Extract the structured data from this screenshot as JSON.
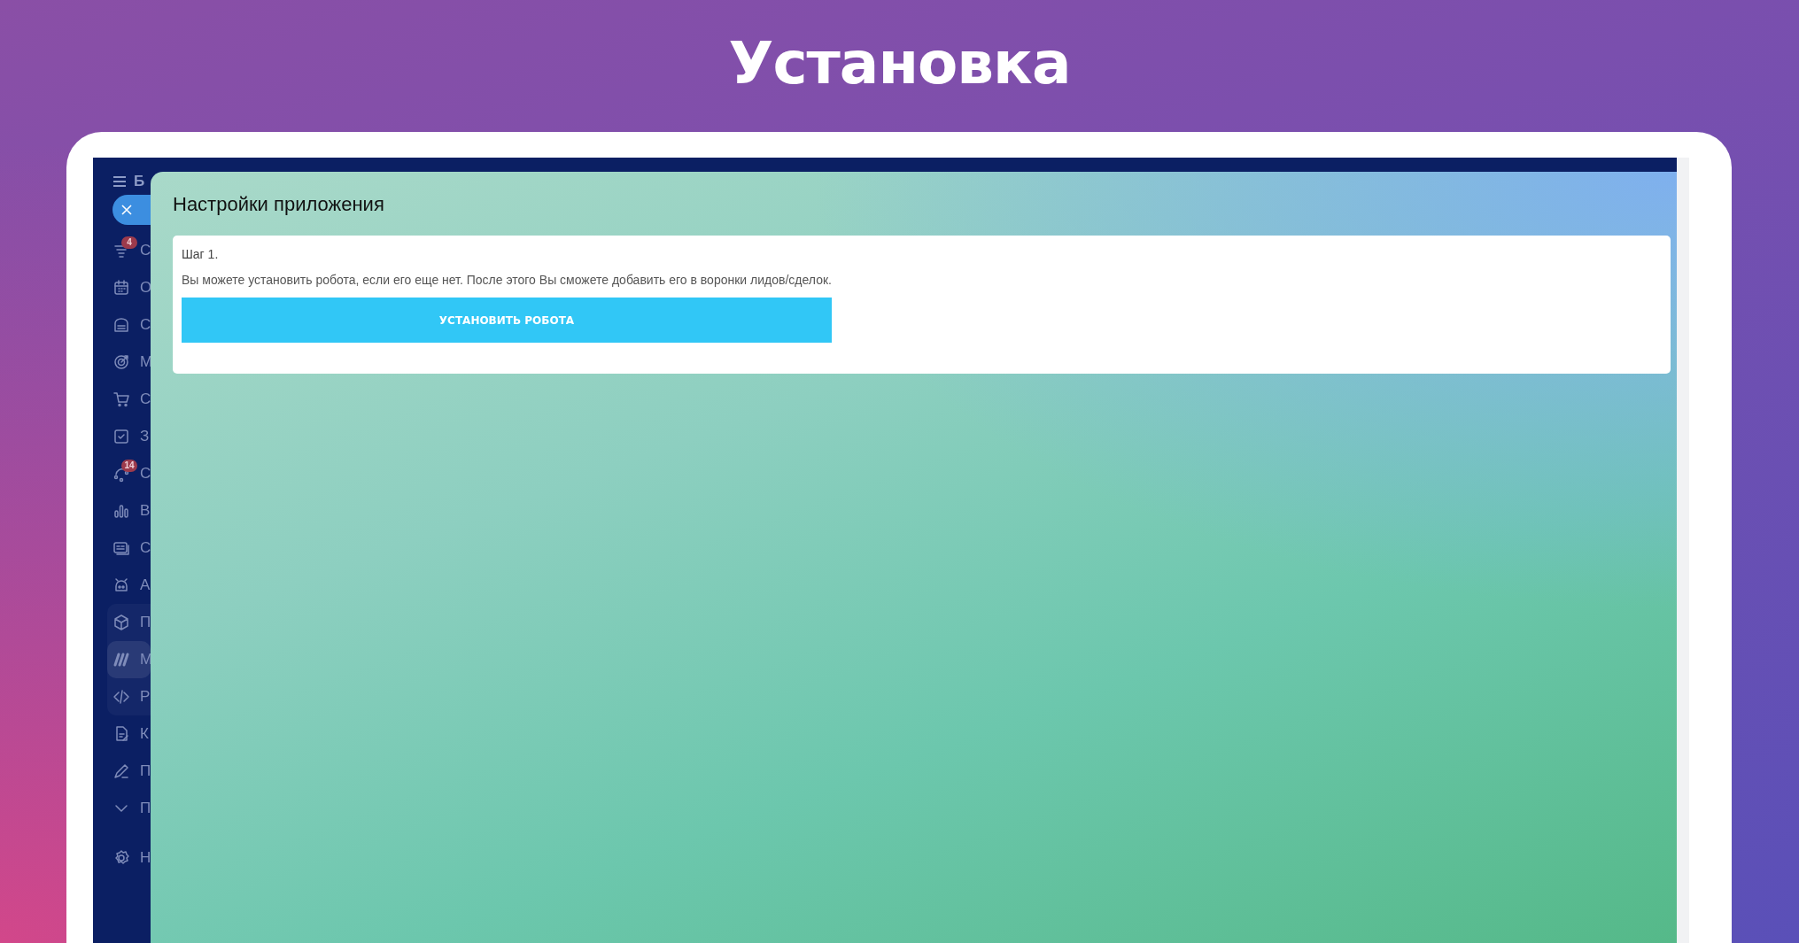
{
  "page_title": "Установка",
  "sidebar": {
    "brand_letter": "Б",
    "items": [
      {
        "kind": "item",
        "label": "С",
        "badge": "4",
        "selected": false
      },
      {
        "kind": "item",
        "label": "О",
        "selected": false
      },
      {
        "kind": "item",
        "label": "С",
        "selected": false
      },
      {
        "kind": "item",
        "label": "М",
        "selected": false
      },
      {
        "kind": "item",
        "label": "С",
        "selected": false
      },
      {
        "kind": "item",
        "label": "З",
        "selected": false
      },
      {
        "kind": "item",
        "label": "С",
        "badge": "14",
        "selected": false
      },
      {
        "kind": "item",
        "label": "В",
        "selected": false
      },
      {
        "kind": "item",
        "label": "С",
        "selected": false
      },
      {
        "kind": "item",
        "label": "А",
        "selected": false
      },
      {
        "kind": "group",
        "items": [
          {
            "label": "П",
            "selected": false
          },
          {
            "label": "М",
            "selected": true
          },
          {
            "label": "Р",
            "selected": false
          }
        ]
      },
      {
        "kind": "item",
        "label": "К",
        "selected": false
      },
      {
        "kind": "item",
        "label": "П",
        "selected": false
      },
      {
        "kind": "item",
        "label": "П",
        "selected": false
      },
      {
        "kind": "gap"
      },
      {
        "kind": "item",
        "label": "Н",
        "selected": false
      }
    ]
  },
  "panel": {
    "title": "Настройки приложения",
    "step": {
      "heading": "Шаг 1.",
      "text": "Вы можете установить робота, если его еще нет. После этого Вы сможете добавить его в воронки лидов/сделок.",
      "button": "УСТАНОВИТЬ РОБОТА"
    }
  }
}
